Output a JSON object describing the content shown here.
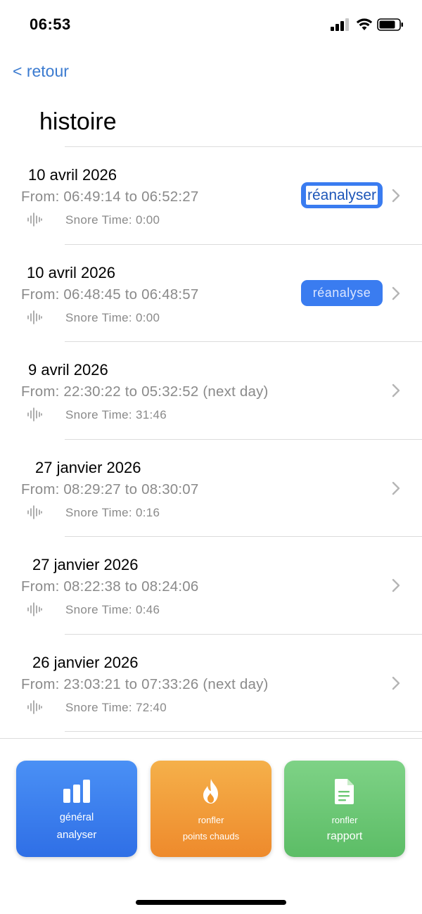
{
  "status_bar": {
    "time": "06:53"
  },
  "nav": {
    "back_label": "< retour",
    "title": "histoire"
  },
  "history": [
    {
      "date": "10 avril 2026",
      "range": "From: 06:49:14 to 06:52:27",
      "snore": "Snore Time: 0:00",
      "action": "réanalyser"
    },
    {
      "date": "10 avril 2026",
      "range": "From: 06:48:45 to 06:48:57",
      "snore": "Snore Time: 0:00",
      "action": "réanalyse"
    },
    {
      "date": "9 avril 2026",
      "range": "From: 22:30:22 to 05:32:52 (next day)",
      "snore": "Snore Time: 31:46"
    },
    {
      "date": "27 janvier 2026",
      "range": "From: 08:29:27 to 08:30:07",
      "snore": "Snore Time: 0:16"
    },
    {
      "date": "27 janvier 2026",
      "range": "From: 08:22:38 to 08:24:06",
      "snore": "Snore Time: 0:46"
    },
    {
      "date": "26 janvier 2026",
      "range": "From: 23:03:21 to 07:33:26 (next day)",
      "snore": "Snore Time: 72:40"
    }
  ],
  "tiles": [
    {
      "line1": "général",
      "line2": "analyser",
      "icon": "bar-chart-icon",
      "color": "#3a7cf0"
    },
    {
      "line1": "ronfler",
      "line2": "points chauds",
      "icon": "flame-icon",
      "color": "#f0982f"
    },
    {
      "line1": "ronfler",
      "line2": "rapport",
      "icon": "document-icon",
      "color": "#6cc874"
    }
  ],
  "colors": {
    "accent": "#3b7bd0",
    "secondary_text": "#8a8a8a"
  }
}
